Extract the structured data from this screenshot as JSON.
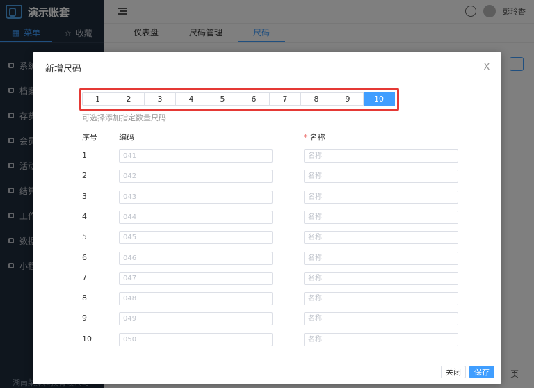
{
  "app": {
    "title": "演示账套",
    "footer": "湖南某某科技有限公司"
  },
  "sidebar": {
    "tabs": [
      {
        "label": "菜单",
        "icon": "grid-icon"
      },
      {
        "label": "收藏",
        "icon": "star-icon"
      }
    ],
    "items": [
      {
        "label": "系统"
      },
      {
        "label": "档案"
      },
      {
        "label": "存货"
      },
      {
        "label": "会员"
      },
      {
        "label": "活动"
      },
      {
        "label": "结算"
      },
      {
        "label": "工作"
      },
      {
        "label": "数据"
      },
      {
        "label": "小程"
      }
    ]
  },
  "topbar": {
    "user_name": "彭玲香"
  },
  "navtabs": [
    {
      "label": "仪表盘"
    },
    {
      "label": "尺码管理"
    },
    {
      "label": "尺码"
    }
  ],
  "background": {
    "page_label": "页"
  },
  "dialog": {
    "title": "新增尺码",
    "close_symbol": "X",
    "count_options": [
      "1",
      "2",
      "3",
      "4",
      "5",
      "6",
      "7",
      "8",
      "9",
      "10"
    ],
    "selected_count": "10",
    "hint": "可选择添加指定数量尺码",
    "headers": {
      "index": "序号",
      "code": "编码",
      "name": "名称",
      "required_mark": "*"
    },
    "rows": [
      {
        "index": "1",
        "code_placeholder": "041",
        "name_placeholder": "名称"
      },
      {
        "index": "2",
        "code_placeholder": "042",
        "name_placeholder": "名称"
      },
      {
        "index": "3",
        "code_placeholder": "043",
        "name_placeholder": "名称"
      },
      {
        "index": "4",
        "code_placeholder": "044",
        "name_placeholder": "名称"
      },
      {
        "index": "5",
        "code_placeholder": "045",
        "name_placeholder": "名称"
      },
      {
        "index": "6",
        "code_placeholder": "046",
        "name_placeholder": "名称"
      },
      {
        "index": "7",
        "code_placeholder": "047",
        "name_placeholder": "名称"
      },
      {
        "index": "8",
        "code_placeholder": "048",
        "name_placeholder": "名称"
      },
      {
        "index": "9",
        "code_placeholder": "049",
        "name_placeholder": "名称"
      },
      {
        "index": "10",
        "code_placeholder": "050",
        "name_placeholder": "名称"
      }
    ],
    "buttons": {
      "close": "关闭",
      "save": "保存"
    }
  },
  "colors": {
    "accent": "#409eff",
    "sidebar_bg": "#1f2d3d",
    "highlight_border": "#e53935"
  }
}
